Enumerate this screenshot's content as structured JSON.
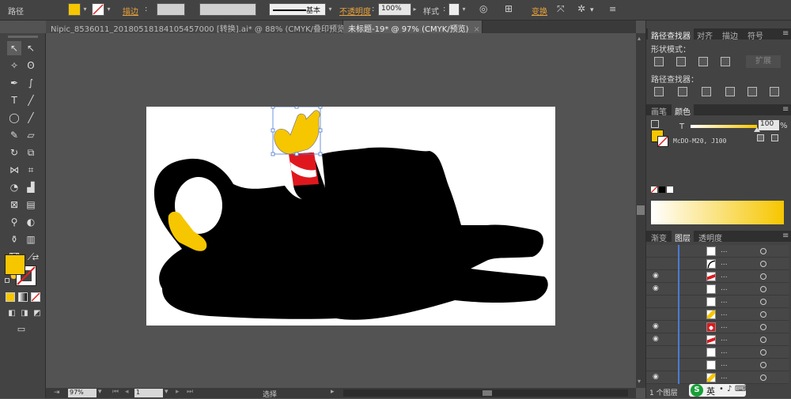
{
  "control_bar": {
    "object_type": "路径",
    "stroke_label": "描边",
    "brush_label": "基本",
    "opacity_label": "不透明度",
    "opacity_value": "100%",
    "style_label": "样式",
    "transform_label": "变换",
    "fill_color": "#f6c600"
  },
  "tabs": [
    {
      "label": "Nipic_8536011_20180518184105457000 [转换].ai* @ 88% (CMYK/叠印预览)",
      "close": "×"
    },
    {
      "label": "未标题-19* @ 97% (CMYK/预览)",
      "close": "×"
    }
  ],
  "status": {
    "zoom": "97%",
    "page": "1",
    "tool": "选择"
  },
  "pathfinder": {
    "tabs": [
      "路径查找器",
      "对齐",
      "描边",
      "符号"
    ],
    "shape_modes_label": "形状模式：",
    "expand_label": "扩展",
    "pathfinders_label": "路径查找器："
  },
  "color_panel": {
    "tabs": [
      "画笔",
      "颜色"
    ],
    "channel": "T",
    "tint_value": "100",
    "percent": "%",
    "swatch_name": "McDO-M20, J100",
    "fill_color": "#f6c600"
  },
  "layers_panel": {
    "tabs": [
      "渐变",
      "图层",
      "透明度"
    ],
    "footer": "1 个图层",
    "rows": [
      {
        "eye": "",
        "thumb": "plain",
        "dots": "..."
      },
      {
        "eye": "",
        "thumb": "curve",
        "dots": "..."
      },
      {
        "eye": "◉",
        "thumb": "red",
        "dots": "..."
      },
      {
        "eye": "◉",
        "thumb": "plain",
        "dots": "..."
      },
      {
        "eye": "",
        "thumb": "plain",
        "dots": "..."
      },
      {
        "eye": "",
        "thumb": "yellow",
        "dots": "..."
      },
      {
        "eye": "◉",
        "thumb": "redwhite",
        "dots": "..."
      },
      {
        "eye": "◉",
        "thumb": "red",
        "dots": "..."
      },
      {
        "eye": "",
        "thumb": "plain",
        "dots": "..."
      },
      {
        "eye": "",
        "thumb": "plain",
        "dots": "..."
      },
      {
        "eye": "◉",
        "thumb": "yellow",
        "dots": "..."
      }
    ]
  },
  "taskbar": {
    "ime": "英",
    "ime_logo": "S"
  }
}
